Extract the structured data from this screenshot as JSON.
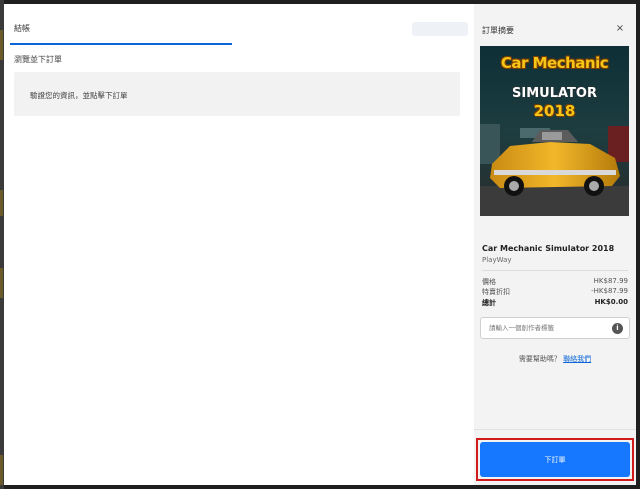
{
  "checkout": {
    "tab_label": "結帳",
    "section_label": "瀏覽並下訂單",
    "info_text": "驗證您的資訊，並點擊下訂單"
  },
  "summary": {
    "title": "訂單摘要",
    "close_icon": "×",
    "cover": {
      "line1": "Car Mechanic",
      "line2": "SIMULATOR",
      "line3": "2018"
    },
    "game_title": "Car Mechanic Simulator 2018",
    "publisher": "PlayWay",
    "rows": [
      {
        "label": "價格",
        "value": "HK$87.99"
      },
      {
        "label": "特賣折扣",
        "value": "-HK$87.99"
      },
      {
        "label": "總計",
        "value": "HK$0.00"
      }
    ],
    "code_placeholder": "請輸入一個創作者標籤",
    "info_icon": "i",
    "help_text": "需要幫助嗎？",
    "help_link": "聯絡我們",
    "order_button": "下訂單"
  },
  "colors": {
    "accent": "#1677ff",
    "highlight": "#d11a1a",
    "tab_underline": "#0a66d8"
  },
  "icons": [
    "close-icon",
    "info-icon"
  ]
}
